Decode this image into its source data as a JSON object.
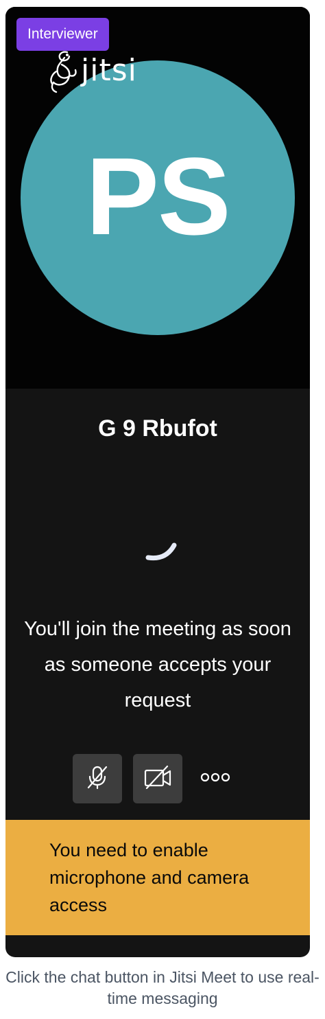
{
  "badge": {
    "label": "Interviewer",
    "color": "#7b3fe4"
  },
  "logo": {
    "text": "jitsi",
    "icon": "jitsi-logo-icon"
  },
  "participant": {
    "initials": "PS",
    "avatar_color": "#4ba6b1"
  },
  "meeting": {
    "name": "G 9 Rbufot"
  },
  "lobby": {
    "message": "You'll join the meeting as soon as someone accepts your request"
  },
  "controls": {
    "mic": {
      "icon": "microphone-muted-icon"
    },
    "camera": {
      "icon": "camera-off-icon"
    },
    "more": {
      "icon": "more-options-icon"
    }
  },
  "warning": {
    "message": "You need to enable microphone and camera access",
    "color": "#ebae42"
  },
  "footer": {
    "note": "Click the chat button in Jitsi Meet to use real-time messaging"
  }
}
